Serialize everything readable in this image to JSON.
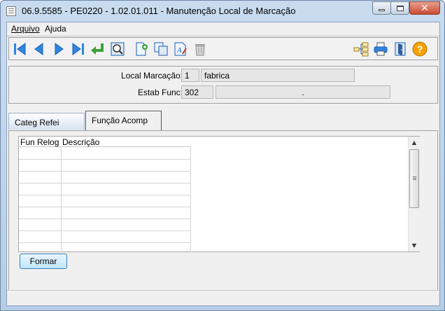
{
  "window": {
    "title": "06.9.5585 - PE0220 - 1.02.01.011 - Manutenção Local de Marcação",
    "close_glyph": "✕"
  },
  "menu": {
    "items": [
      {
        "label": "Arquivo"
      },
      {
        "label": "Ajuda"
      }
    ]
  },
  "toolbar": {
    "buttons": [
      {
        "name": "first-record-icon"
      },
      {
        "name": "previous-record-icon"
      },
      {
        "name": "next-record-icon"
      },
      {
        "name": "last-record-icon"
      },
      {
        "name": "goto-record-icon"
      },
      {
        "name": "search-icon"
      },
      {
        "name": "new-record-icon"
      },
      {
        "name": "copy-record-icon"
      },
      {
        "name": "edit-record-icon"
      },
      {
        "name": "delete-record-icon"
      },
      {
        "name": "tree-navigation-icon"
      },
      {
        "name": "print-icon"
      },
      {
        "name": "exit-icon"
      },
      {
        "name": "help-icon"
      }
    ],
    "help_glyph": "?",
    "accent": "#1a5fb4",
    "arrow_color": "#2e86de",
    "enter_color": "#3aa33a",
    "help_color": "#f5a200"
  },
  "header": {
    "local_marcacao_label": "Local Marcação:",
    "local_marcacao_code": "1",
    "local_marcacao_desc": "fabrica",
    "estab_func_label": "Estab Func:",
    "estab_func_code": "302",
    "estab_func_desc": "."
  },
  "tabs": [
    {
      "label": "Categ Refei",
      "selected": false
    },
    {
      "label": "Função Acomp",
      "selected": true
    }
  ],
  "grid": {
    "columns": [
      "Fun Relog",
      "Descrição"
    ],
    "rows": []
  },
  "scrollbar": {
    "up_glyph": "▲",
    "down_glyph": "▼"
  },
  "actions": {
    "formar_label": "Formar"
  }
}
